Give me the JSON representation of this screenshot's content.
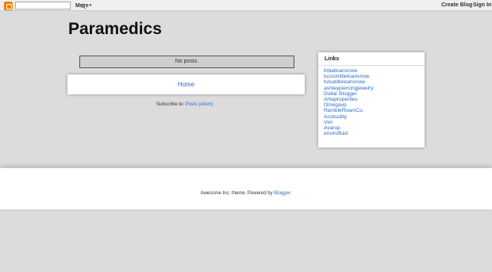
{
  "navbar": {
    "logo_icon": "blogger-logo-icon",
    "search_icon": "search-icon",
    "more_label": "More",
    "more_caret": "▾",
    "create_blog_label": "Create Blog",
    "sign_in_label": "Sign In"
  },
  "header": {
    "title": "Paramedics"
  },
  "main": {
    "no_posts_text": "No posts.",
    "home_link": "Home",
    "subscribe_prefix": "Subscribe to: ",
    "subscribe_link": "Posts (Atom)"
  },
  "sidebar": {
    "links_title": "Links",
    "links": [
      "triballoansnow",
      "tucsontitleloansnow",
      "tulsatitleloansnow",
      "ashleypiercingjewelry",
      "Dollar Blogger",
      "Ahlaproperties",
      "Omegavp",
      "RambleRoamCo.",
      "Accbuddy",
      "Vinr",
      "Avarup",
      "envirofluid"
    ]
  },
  "footer": {
    "text_prefix": "Awesome Inc. theme. Powered by ",
    "blogger_link": "Blogger",
    "text_suffix": "."
  },
  "colors": {
    "background": "#dcdcdc",
    "link": "#2b6cc4",
    "blogger_orange": "#f57d00"
  }
}
